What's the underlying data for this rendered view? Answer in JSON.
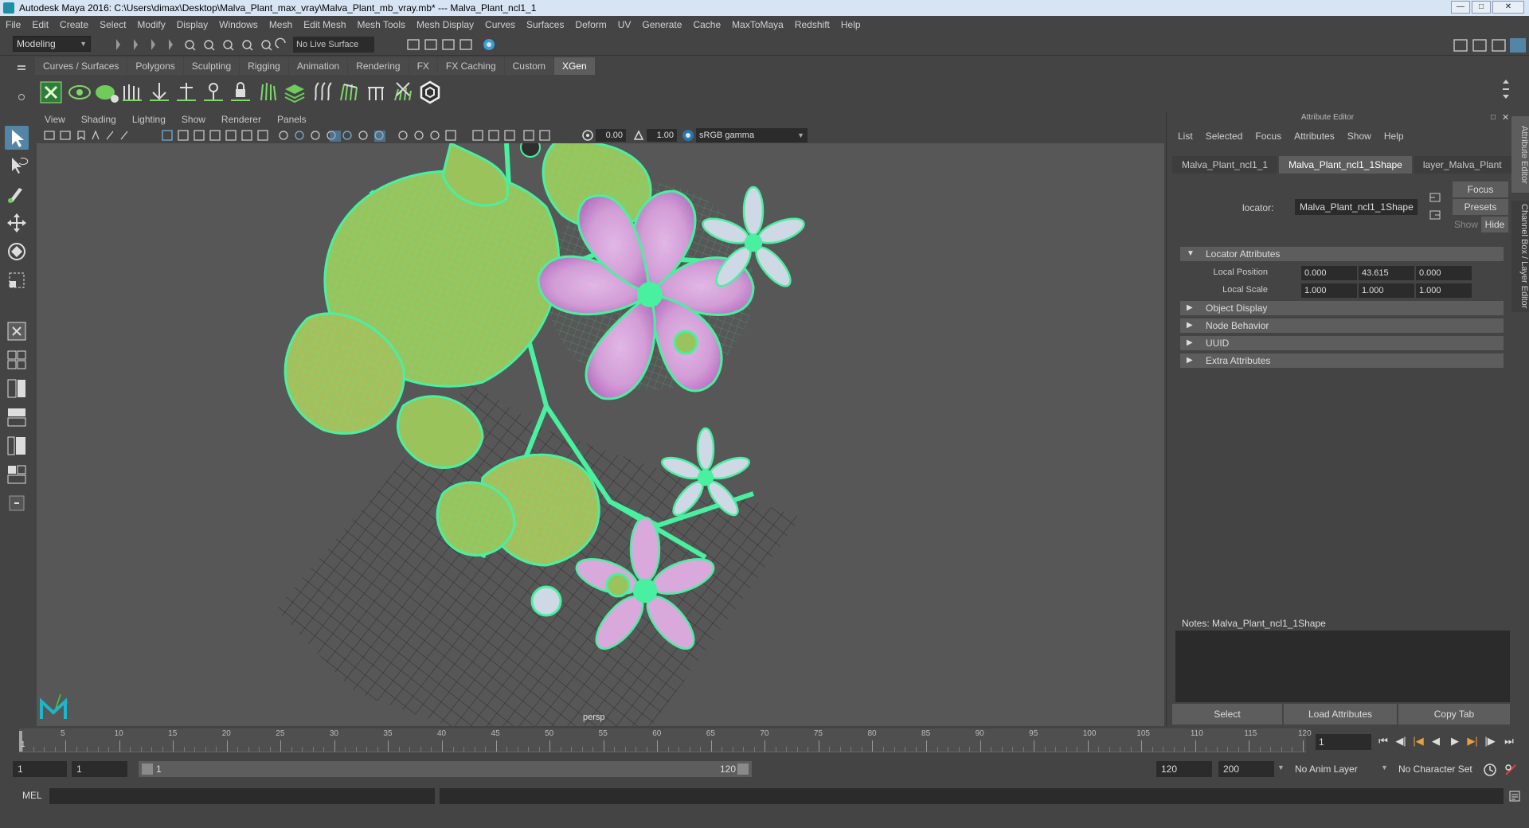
{
  "window": {
    "title": "Autodesk Maya 2016: C:\\Users\\dimax\\Desktop\\Malva_Plant_max_vray\\Malva_Plant_mb_vray.mb*   ---   Malva_Plant_ncl1_1"
  },
  "menubar": [
    "File",
    "Edit",
    "Create",
    "Select",
    "Modify",
    "Display",
    "Windows",
    "Mesh",
    "Edit Mesh",
    "Mesh Tools",
    "Mesh Display",
    "Curves",
    "Surfaces",
    "Deform",
    "UV",
    "Generate",
    "Cache",
    "MaxToMaya",
    "Redshift",
    "Help"
  ],
  "statusline": {
    "mode": "Modeling",
    "live_surface": "No Live Surface"
  },
  "shelf": {
    "tabs": [
      "Curves / Surfaces",
      "Polygons",
      "Sculpting",
      "Rigging",
      "Animation",
      "Rendering",
      "FX",
      "FX Caching",
      "Custom",
      "XGen"
    ],
    "active_tab": "XGen"
  },
  "viewport": {
    "menu": [
      "View",
      "Shading",
      "Lighting",
      "Show",
      "Renderer",
      "Panels"
    ],
    "exposure": "0.00",
    "gamma_value": "1.00",
    "color_space": "sRGB gamma",
    "camera": "persp"
  },
  "attribute_editor": {
    "title": "Attribute Editor",
    "menu": [
      "List",
      "Selected",
      "Focus",
      "Attributes",
      "Show",
      "Help"
    ],
    "tabs": [
      "Malva_Plant_ncl1_1",
      "Malva_Plant_ncl1_1Shape",
      "layer_Malva_Plant"
    ],
    "active_tab": "Malva_Plant_ncl1_1Shape",
    "buttons": {
      "focus": "Focus",
      "presets": "Presets",
      "show": "Show",
      "hide": "Hide"
    },
    "locator_label": "locator:",
    "locator_value": "Malva_Plant_ncl1_1Shape",
    "sections": {
      "locator_attributes": "Locator Attributes",
      "object_display": "Object Display",
      "node_behavior": "Node Behavior",
      "uuid": "UUID",
      "extra_attributes": "Extra Attributes"
    },
    "local_position": {
      "label": "Local Position",
      "x": "0.000",
      "y": "43.615",
      "z": "0.000"
    },
    "local_scale": {
      "label": "Local Scale",
      "x": "1.000",
      "y": "1.000",
      "z": "1.000"
    },
    "notes_label": "Notes:  Malva_Plant_ncl1_1Shape",
    "bottom": {
      "select": "Select",
      "load": "Load Attributes",
      "copy": "Copy Tab"
    },
    "side_tabs": [
      "Attribute Editor",
      "Channel Box / Layer Editor"
    ]
  },
  "timeline": {
    "ticks": [
      "5",
      "10",
      "15",
      "20",
      "25",
      "30",
      "35",
      "40",
      "45",
      "50",
      "55",
      "60",
      "65",
      "70",
      "75",
      "80",
      "85",
      "90",
      "95",
      "100",
      "105",
      "110",
      "115",
      "120"
    ],
    "start_label": "1",
    "current_frame": "1"
  },
  "range": {
    "start": "1",
    "inner_start": "1",
    "bar_start": "1",
    "bar_end": "120",
    "end": "120",
    "max_end": "200",
    "anim_layer": "No Anim Layer",
    "character_set": "No Character Set"
  },
  "command": {
    "language": "MEL"
  },
  "colors": {
    "wire": "#48f0a0",
    "leaf": "#9bc35c",
    "petal": "#d79ad8",
    "grid": "#2e2e2e",
    "accent": "#5285a6"
  }
}
